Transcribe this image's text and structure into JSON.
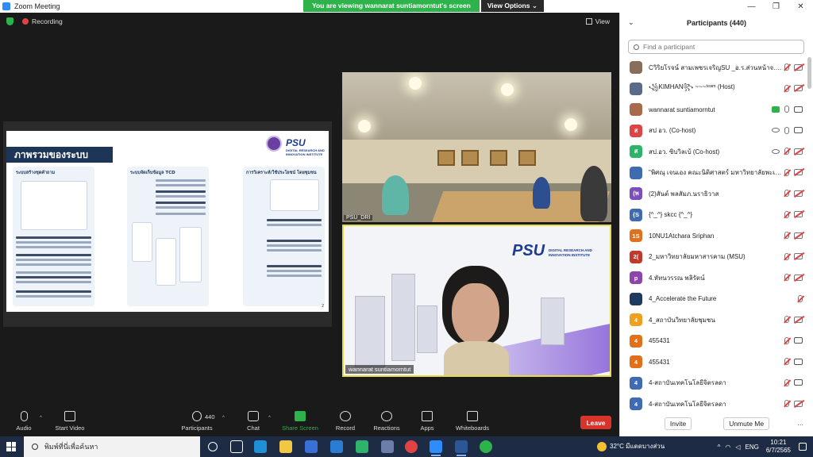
{
  "window": {
    "title": "Zoom Meeting",
    "controls": [
      "—",
      "❐",
      "✕"
    ]
  },
  "banner": {
    "message": "You are viewing wannarat suntiamorntut's screen",
    "options_label": "View Options ⌄"
  },
  "top": {
    "recording_label": "Recording",
    "view_label": "View"
  },
  "slide": {
    "heading": "ภาพรวมของระบบ",
    "logo_text": "PSU",
    "logo_sub": "DIGITAL RESEARCH AND INNOVATION INSTITUTE",
    "columns": [
      {
        "title": "ระบบสร้างชุดคำถาม"
      },
      {
        "title": "ระบบจัดเก็บข้อมูล TCD"
      },
      {
        "title": "การวิเคราะห์/ใช้ประโยชน์ โดยชุมชน"
      }
    ],
    "page_number": "2"
  },
  "videos": {
    "room_name": "PSU_DRI",
    "speaker_logo": "PSU",
    "speaker_logo_sub": "DIGITAL RESEARCH AND INNOVATION INSTITUTE",
    "speaker_name": "wannarat suntiamorntut"
  },
  "toolbar": {
    "audio": "Audio",
    "video": "Start Video",
    "participants": "Participants",
    "participants_count": "440",
    "chat": "Chat",
    "share": "Share Screen",
    "record": "Record",
    "reactions": "Reactions",
    "apps": "Apps",
    "whiteboards": "Whiteboards",
    "leave": "Leave"
  },
  "panel": {
    "title": "Participants (440)",
    "search_placeholder": "Find a participant",
    "participants": [
      {
        "name": "Cวิริยโรจน์ สามเพชรเจริญSU _อ.ร.ส่วนหน้าจ.รา... (Me)",
        "avatar": "",
        "avatar_color": "#8a6d5a",
        "mic": "muted",
        "cam": "muted"
      },
      {
        "name": "꧁KIMHAN꧂ ~~~ᵗᵉᵃᵐ (Host)",
        "avatar": "",
        "avatar_color": "#5a6b8a",
        "mic": "muted",
        "cam": "muted"
      },
      {
        "name": "wannarat suntiamorntut",
        "avatar": "",
        "avatar_color": "#a86a4a",
        "mic": "on",
        "cam": "on",
        "sharing": true
      },
      {
        "name": "สป อว. (Co-host)",
        "avatar": "ส",
        "avatar_color": "#e04343",
        "mic": "on",
        "cam": "on",
        "viewing": true
      },
      {
        "name": "สป.อว. ซิบวิลเบ้ (Co-host)",
        "avatar": "ส",
        "avatar_color": "#2eb36b",
        "mic": "muted",
        "cam": "muted",
        "viewing": true
      },
      {
        "name": "\"พิศณุ เจนเอง คณะนิติศาสตร์ มหาวิทยาลัยพะเยา\"",
        "avatar": "",
        "avatar_color": "#3f6bb3",
        "mic": "muted",
        "cam": "muted"
      },
      {
        "name": "(2)สันต์ พลสัมภ.นราธิวาส",
        "avatar": "(พ",
        "avatar_color": "#7a4fc0",
        "mic": "muted",
        "cam": "muted"
      },
      {
        "name": "{^_^} skcc {^_^}",
        "avatar": "{S",
        "avatar_color": "#3f6bb3",
        "mic": "muted",
        "cam": "muted"
      },
      {
        "name": "10NU1Atchara Sriphan",
        "avatar": "1S",
        "avatar_color": "#e2701a",
        "mic": "muted",
        "cam": "muted"
      },
      {
        "name": "2_มหาวิทยาลัยมหาสารคาม (MSU)",
        "avatar": "2(",
        "avatar_color": "#c0392b",
        "mic": "muted",
        "cam": "muted"
      },
      {
        "name": "4.หัทนวรรณ พลิรัตน์",
        "avatar": "p",
        "avatar_color": "#8e44ad",
        "mic": "muted",
        "cam": "muted"
      },
      {
        "name": "4_Accelerate the Future",
        "avatar": "",
        "avatar_color": "#1f3a5f",
        "mic": "muted",
        "cam": "none"
      },
      {
        "name": "4_สถาบันวิทยาลัยชุมชน",
        "avatar": "4",
        "avatar_color": "#f0a020",
        "mic": "muted",
        "cam": "muted"
      },
      {
        "name": "455431",
        "avatar": "4",
        "avatar_color": "#e2701a",
        "mic": "muted",
        "cam": "on"
      },
      {
        "name": "455431",
        "avatar": "4",
        "avatar_color": "#e2701a",
        "mic": "muted",
        "cam": "on"
      },
      {
        "name": "4-สถาบันเทคโนโลยีจิตรลดา",
        "avatar": "4",
        "avatar_color": "#3f6bb3",
        "mic": "muted",
        "cam": "on"
      },
      {
        "name": "4-สถาบันเทคโนโลยีจิตรลดา",
        "avatar": "4",
        "avatar_color": "#3f6bb3",
        "mic": "muted",
        "cam": "muted"
      }
    ],
    "invite": "Invite",
    "unmute_me": "Unmute Me",
    "more": "..."
  },
  "taskbar": {
    "search_text": "พิมพ์ที่นี่เพื่อค้นหา",
    "weather": "32°C มีแดดบางส่วน",
    "language": "ENG",
    "time": "10:21",
    "date": "6/7/2565"
  }
}
